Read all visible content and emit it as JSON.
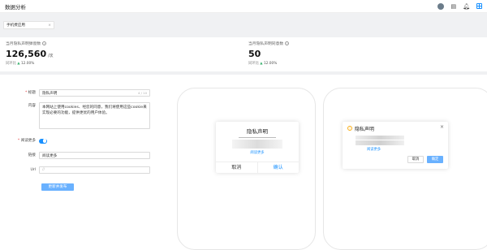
{
  "app": {
    "title": "数据分析"
  },
  "header_icons": [
    "avatar",
    "document-icon",
    "bell-icon",
    "grid-icon"
  ],
  "filter": {
    "selected": "手机费应用",
    "clear": "×"
  },
  "stats": [
    {
      "label": "当月隐私声明弹窗数",
      "value": "126,560",
      "unit": "/次",
      "compare_label": "同环比",
      "compare_value": "12.00%"
    },
    {
      "label": "当月隐私声明同意数",
      "value": "50",
      "unit": "",
      "compare_label": "同环比",
      "compare_value": "12.00%"
    }
  ],
  "form": {
    "title_label": "标题",
    "title_value": "隐私声明",
    "title_count": "4 / 10",
    "content_label": "内容",
    "content_value": "本网站上使用cookies、经您的同意，我们将使用这些cookie来实现必要的功能，提供更优的用户体验。",
    "read_more_label": "阅读更多",
    "link_text_label": "链接",
    "link_text_value": "阅读更多",
    "url_label": "Url",
    "url_placeholder": "//",
    "submit_label": "更新并发布"
  },
  "preview_mobile": {
    "title": "隐私声明",
    "link": "阅读更多",
    "cancel": "取消",
    "ok": "确认"
  },
  "preview_desktop": {
    "title": "隐私声明",
    "link": "阅读更多",
    "cancel": "取消",
    "ok": "确定",
    "close": "×"
  },
  "colors": {
    "accent": "#1890ff",
    "primary_button": "#69b1ff",
    "warning": "#faad14",
    "panel_bg": "#f0f1f3"
  }
}
